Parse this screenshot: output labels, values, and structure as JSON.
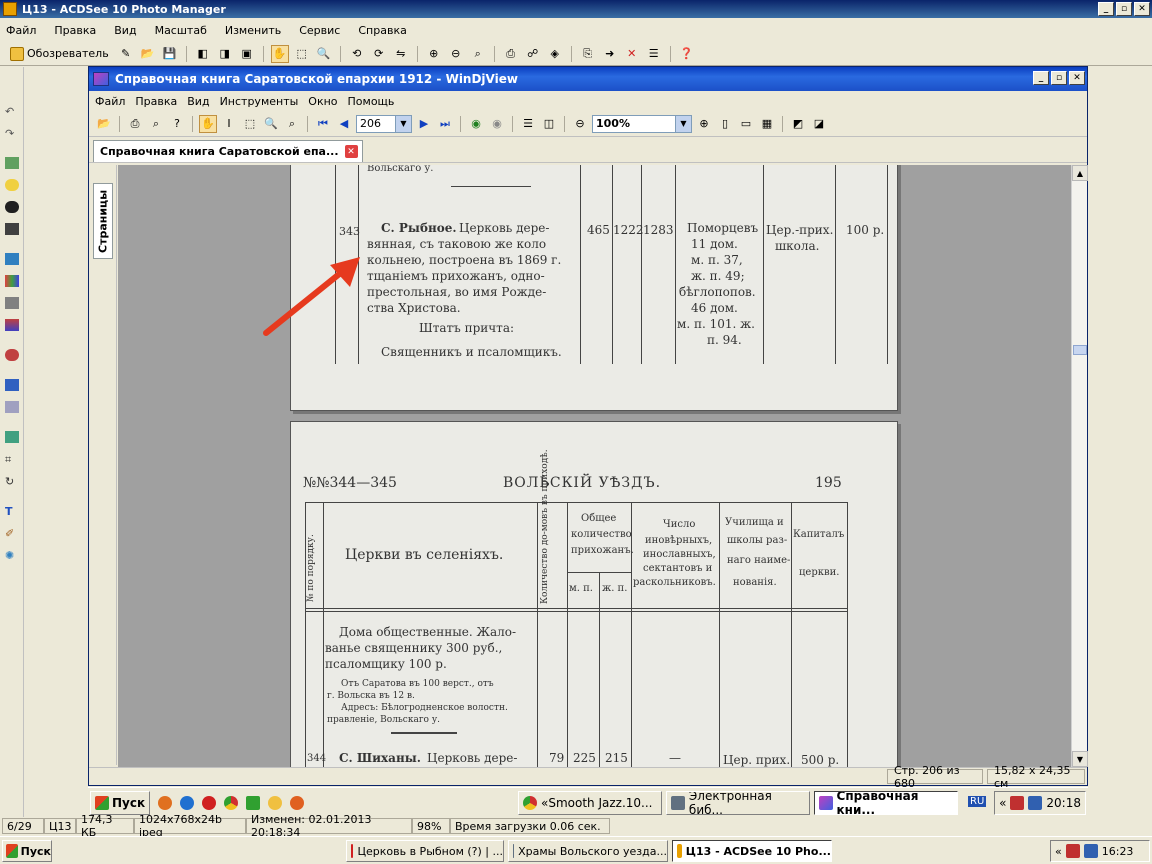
{
  "outer": {
    "title": "Ц13 - ACDSee 10 Photo Manager",
    "menu": [
      "Файл",
      "Правка",
      "Вид",
      "Масштаб",
      "Изменить",
      "Сервис",
      "Справка"
    ],
    "browser_label": "Обозреватель"
  },
  "inner": {
    "title": "Справочная книга Саратовской епархии 1912 - WinDjView",
    "menu": [
      "Файл",
      "Правка",
      "Вид",
      "Инструменты",
      "Окно",
      "Помощь"
    ],
    "page_number": "206",
    "zoom": "100%",
    "doc_tab": "Справочная книга Саратовской епа...",
    "side_tab": "Страницы",
    "status_page": "Стр. 206 из 680",
    "status_size": "15,82 x 24,35 см"
  },
  "page1": {
    "header_fragment": "Вольскаго у.",
    "row_num": "343",
    "title_bold": "С. Рыбное.",
    "desc_lines": [
      "Церковь дере-",
      "вянная, съ таковою же коло",
      "кольнею, построена въ 1869 г.",
      "тщаніемъ прихожанъ, одно-",
      "престольная, во имя Рожде-",
      "ства Христова."
    ],
    "staff_title": "Штатъ причта:",
    "staff_desc": "Священникъ и псаломщикъ.",
    "households": "465",
    "males": "1222",
    "females": "1283",
    "others": [
      "Поморцевъ",
      "11 дом.",
      "м. п. 37,",
      "ж. п. 49;",
      "бѣглопопов.",
      "46 дом.",
      "м. п. 101. ж.",
      "п. 94."
    ],
    "school": [
      "Цер.-прих.",
      "школа."
    ],
    "capital": "100 р."
  },
  "page2": {
    "page_range": "№№344—345",
    "uyezd": "ВОЛЬСКІЙ УѢЗДЪ.",
    "page_no": "195",
    "col_order": "№ по порядку.",
    "col_churches": "Церкви въ селеніяхъ.",
    "col_households": "Количество до-мовъ въ приходѣ.",
    "col_parish": [
      "Общее",
      "количество",
      "прихожанъ."
    ],
    "col_m": "м. п.",
    "col_f": "ж. п.",
    "col_others": [
      "Число",
      "иновѣрныхъ,",
      "инославныхъ,",
      "сектантовъ и",
      "раскольниковъ."
    ],
    "col_schools": [
      "Училища и",
      "школы раз-",
      "наго наиме-",
      "нованія."
    ],
    "col_capital": [
      "Капиталъ",
      "церкви."
    ],
    "text_lines": [
      "Дома общественные. Жало-",
      "ванье священнику 300 руб.,",
      "псаломщику 100 р."
    ],
    "small_lines": [
      "Отъ Саратова въ 100 верст., отъ",
      "г. Вольска въ 12 в.",
      "Адресъ: Бѣлогродненское волостн.",
      "правленіе, Вольскаго у."
    ],
    "next_row_num": "344",
    "next_title": "С. Шиханы.",
    "next_desc": "Церковь дере-",
    "next_households": "79",
    "next_m": "225",
    "next_f": "215",
    "next_others": "—",
    "next_school": "Цер. прих.",
    "next_capital": "500 р."
  },
  "inner_taskbar": {
    "start": "Пуск",
    "tasks": [
      "«Smooth Jazz.10...",
      "Электронная биб...",
      "Справочная кни..."
    ],
    "lang": "RU",
    "time": "20:18"
  },
  "outer_status": {
    "index": "6/29",
    "name": "Ц13",
    "size": "174,3 КБ",
    "dims": "1024x768x24b jpeg",
    "modified": "Изменен: 02.01.2013 20:18:34",
    "zoom": "98%",
    "load": "Время загрузки 0.06 сек."
  },
  "taskbar": {
    "start": "Пуск",
    "tasks": [
      "Церковь в Рыбном (?) | ...",
      "Храмы Вольского уезда...",
      "Ц13 - ACDSee 10 Pho..."
    ],
    "time": "16:23"
  },
  "colors": {
    "arrow": "#e63a1e",
    "title_blue": "#0a246a",
    "page_bg": "#ebebe6"
  }
}
